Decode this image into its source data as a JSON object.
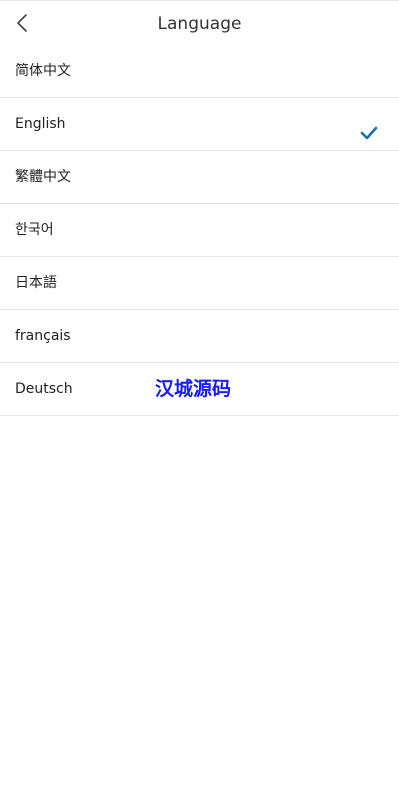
{
  "header": {
    "title": "Language",
    "back_icon": "chevron-left-icon"
  },
  "languages": [
    {
      "label": "简体中文",
      "selected": false
    },
    {
      "label": "English",
      "selected": true
    },
    {
      "label": "繁體中文",
      "selected": false
    },
    {
      "label": "한국어",
      "selected": false
    },
    {
      "label": "日本語",
      "selected": false
    },
    {
      "label": "français",
      "selected": false
    },
    {
      "label": "Deutsch",
      "selected": false
    }
  ],
  "check_icon": "checkmark-icon",
  "watermark": {
    "text": "汉城源码",
    "color": "#1a1aff"
  },
  "colors": {
    "accent": "#1a6fb5",
    "divider": "#e5e5e5",
    "text": "#222222"
  }
}
